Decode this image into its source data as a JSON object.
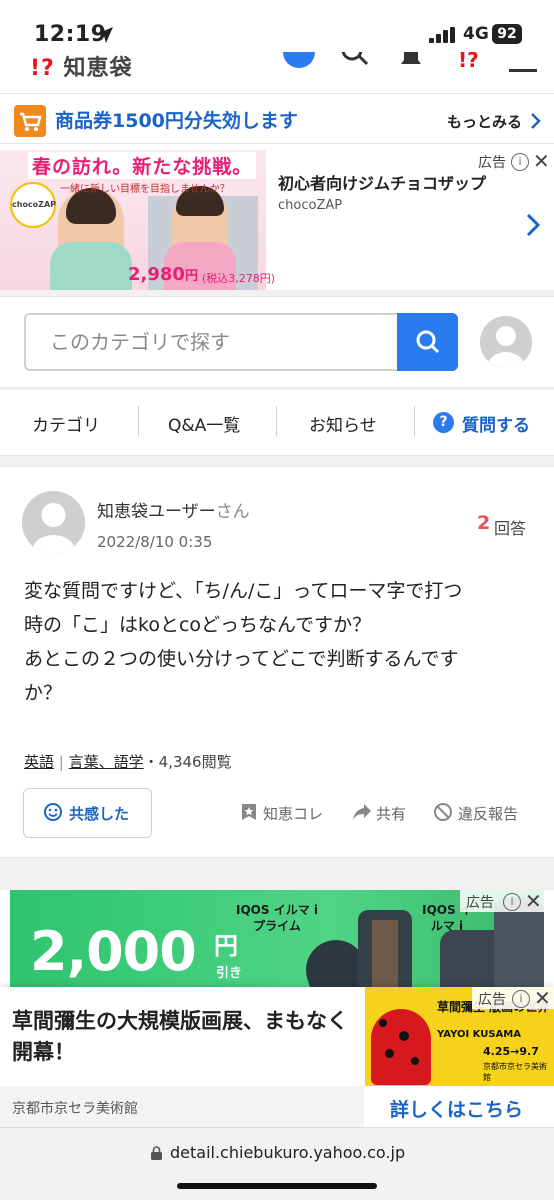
{
  "status": {
    "time": "12:19",
    "network": "4G",
    "battery": "92"
  },
  "header": {
    "logo_text": "知恵袋"
  },
  "promo": {
    "text": "商品券1500円分失効します",
    "more": "もっとみる"
  },
  "ad1": {
    "label": "広告",
    "headline": "春の訪れ。新たな挑戦。",
    "subline": "一緒に新しい目標を目指しませんか？",
    "badge": "chocoZAP",
    "price": "2,980",
    "price_unit": "円",
    "tax_note": "(税込3,278円)",
    "title": "初心者向けジムチョコザップ",
    "brand": "chocoZAP"
  },
  "search": {
    "placeholder": "このカテゴリで探す"
  },
  "nav": {
    "items": [
      "カテゴリ",
      "Q&A一覧",
      "お知らせ"
    ],
    "ask": "質問する"
  },
  "question": {
    "user": "知恵袋ユーザー",
    "honorific": "さん",
    "date": "2022/8/10 0:35",
    "answer_count": "2",
    "answer_label": "回答",
    "body_lines": [
      "変な質問ですけど、「ち/ん/こ」ってローマ字で打つ",
      "時の「こ」はkoとcoどっちなんですか？",
      "あとこの２つの使い分けってどこで判断するんです",
      "か？"
    ],
    "tags": [
      "英語",
      "言葉、語学"
    ],
    "tag_sep": "|",
    "views": "・4,346閲覧",
    "empathy": "共感した",
    "actions": [
      "知恵コレ",
      "共有",
      "違反報告"
    ]
  },
  "ad2": {
    "label": "広告",
    "big_text": "2,000",
    "unit": "円",
    "unit_sub": "引き",
    "product_a": "IQOS イルマ i プライム",
    "product_b": "IQOS イルマ i"
  },
  "banner": {
    "label": "広告",
    "title": "草間彌生の大規模版画展、まもなく開幕！",
    "sponsor": "京都市京セラ美術館",
    "cta": "詳しくはこちら",
    "poster_title": "草間彌生 版画の世界",
    "poster_en": "YAYOI KUSAMA",
    "poster_date": "4.25→9.7",
    "poster_venue": "京都市京セラ美術館"
  },
  "url": {
    "host": "detail.chiebukuro.yahoo.co.jp"
  },
  "colors": {
    "accent": "#2b7bf0",
    "link": "#1a64c8",
    "answer": "#e8505b",
    "promo_icon": "#f08a1c"
  }
}
